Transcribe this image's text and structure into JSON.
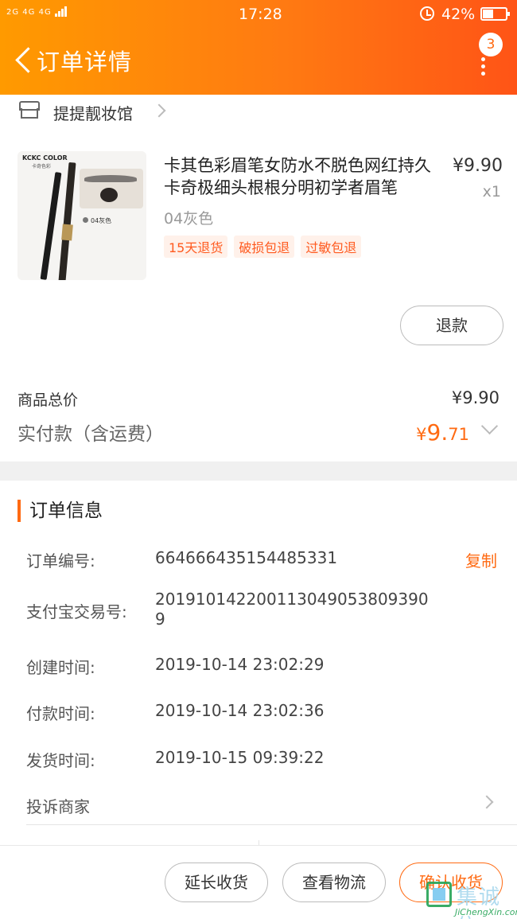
{
  "status_bar": {
    "signal": "2G 4G 4G",
    "time": "17:28",
    "battery_pct": "42%"
  },
  "header": {
    "title": "订单详情",
    "badge_count": "3"
  },
  "shop": {
    "name": "提提靓妆馆"
  },
  "product": {
    "image": {
      "brand": "KCKC COLOR",
      "sub": "卡奇色彩",
      "label": "04灰色"
    },
    "title": "卡其色彩眉笔女防水不脱色网红持久卡奇极细头根根分明初学者眉笔",
    "price": "¥9.90",
    "qty": "x1",
    "variant": "04灰色",
    "tags": [
      "15天退货",
      "破损包退",
      "过敏包退"
    ],
    "refund_label": "退款"
  },
  "summary": {
    "total_label": "商品总价",
    "total_value": "¥9.90",
    "paid_label": "实付款（含运费）",
    "paid_currency": "¥",
    "paid_int": "9.",
    "paid_dec": "71"
  },
  "order_info": {
    "title": "订单信息",
    "copy_label": "复制",
    "rows": [
      {
        "label": "订单编号:",
        "value": "664666435154485331"
      },
      {
        "label": "支付宝交易号:",
        "value": "2019101422001130490538093909"
      },
      {
        "label": "创建时间:",
        "value": "2019-10-14 23:02:29"
      },
      {
        "label": "付款时间:",
        "value": "2019-10-14 23:02:36"
      },
      {
        "label": "发货时间:",
        "value": "2019-10-15 09:39:22"
      }
    ],
    "complain_label": "投诉商家"
  },
  "footer": {
    "extend_label": "延长收货",
    "logistics_label": "查看物流",
    "confirm_label": "确认收货"
  },
  "watermark": {
    "text": "集诚信",
    "url": "JiChengXin.com"
  },
  "colors": {
    "accent": "#ff6a12",
    "header_start": "#ff9a00",
    "header_end": "#ff5416"
  }
}
